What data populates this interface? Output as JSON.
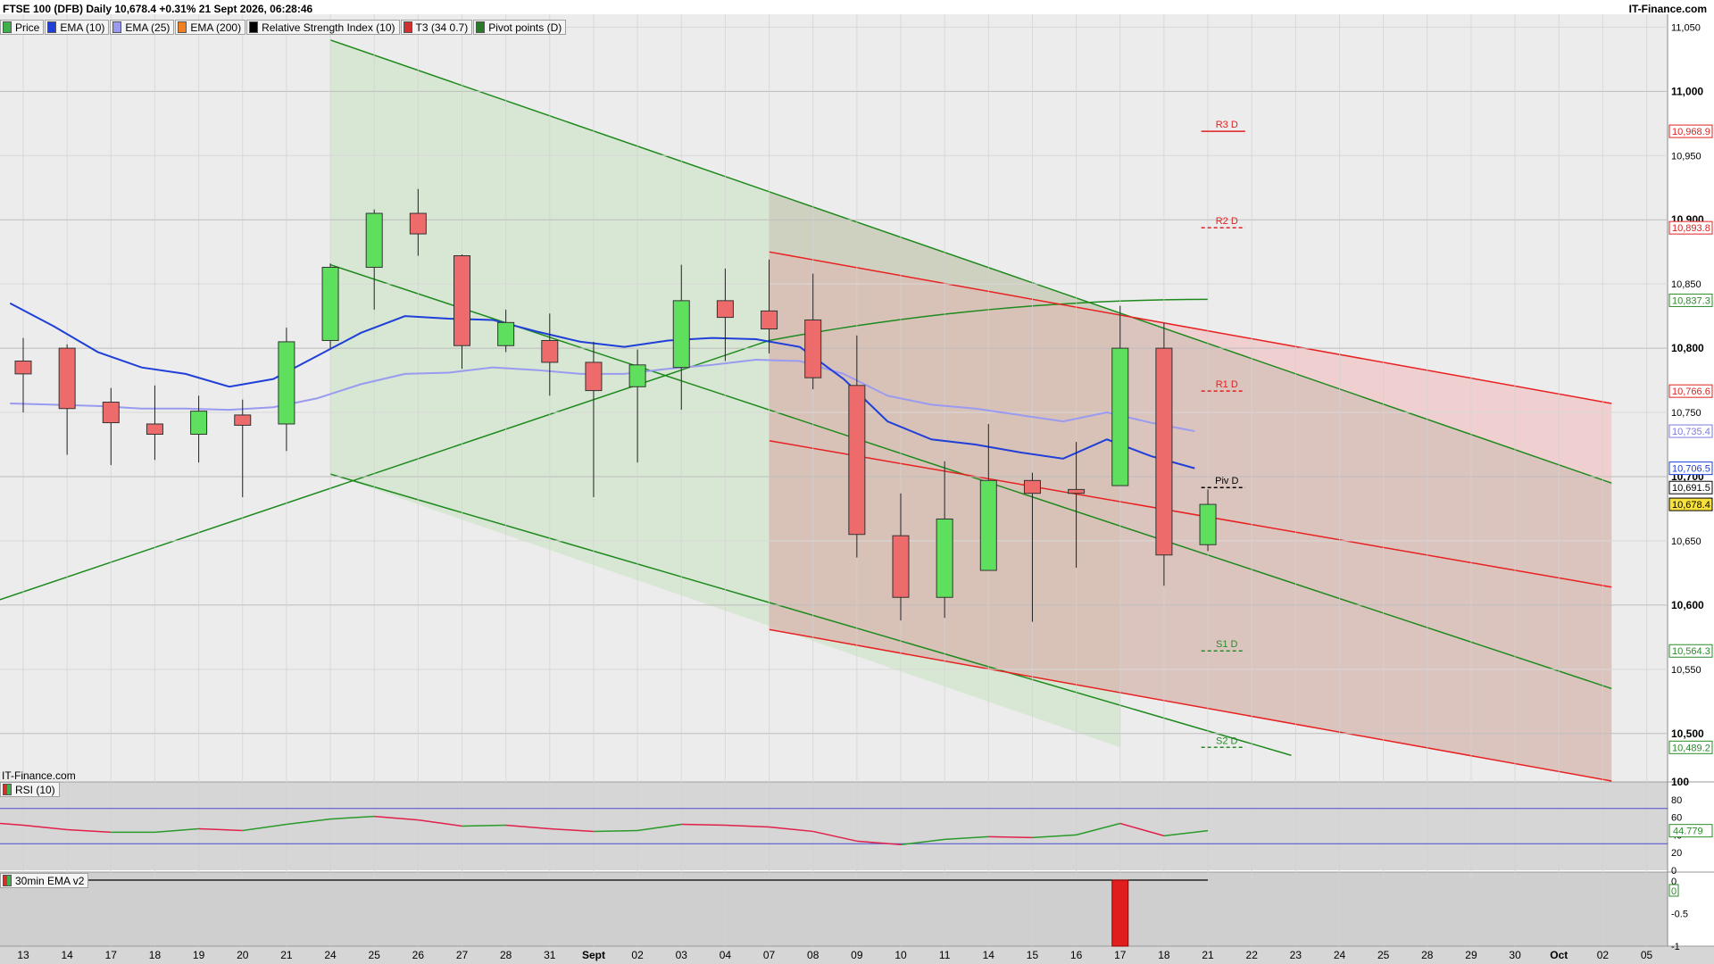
{
  "header": {
    "title": "FTSE 100 (DFB) Daily 10,678.4 +0.31% 21 Sept 2026, 06:28:46",
    "brand": "IT-Finance.com"
  },
  "legend": [
    {
      "label": "Price",
      "color": "#3db24a"
    },
    {
      "label": "EMA (10)",
      "color": "#1f3fd8"
    },
    {
      "label": "EMA (25)",
      "color": "#9a9af0"
    },
    {
      "label": "EMA (200)",
      "color": "#f08020"
    },
    {
      "label": "Relative Strength Index (10)",
      "color": "#000000"
    },
    {
      "label": "T3 (34 0.7)",
      "color": "#d03030"
    },
    {
      "label": "Pivot points (D)",
      "color": "#2a7a2a"
    }
  ],
  "watermark": "IT-Finance.com",
  "rsi_panel": {
    "label": "RSI (10)",
    "ticks": [
      "100",
      "80",
      "60",
      "40",
      "20",
      "0"
    ],
    "current": "44.779"
  },
  "ema30_panel": {
    "label": "30min EMA v2",
    "ticks": [
      "0",
      "-0.5",
      "-1"
    ],
    "current": "0"
  },
  "colors": {
    "up": "#5ee05e",
    "down": "#ee6b6b",
    "ema10": "#1f3fd8",
    "ema25": "#9a9af0",
    "channel_green": "#1e8a1e",
    "channel_red": "#e82020"
  },
  "price_axis": {
    "labels": [
      "11,050",
      "11,000",
      "10,950",
      "10,900",
      "10,850",
      "10,800",
      "10,750",
      "10,700",
      "10,650",
      "10,600",
      "10,550",
      "10,500"
    ]
  },
  "price_tags": [
    {
      "text": "10,968.9",
      "color": "#e02020",
      "bg": "#ffffff"
    },
    {
      "text": "10,893.8",
      "color": "#e02020",
      "bg": "#ffffff"
    },
    {
      "text": "10,837.3",
      "color": "#2a8a2a",
      "bg": "#ffffff"
    },
    {
      "text": "10,766.6",
      "color": "#e02020",
      "bg": "#ffffff"
    },
    {
      "text": "10,735.4",
      "color": "#7a7ae0",
      "bg": "#ffffff"
    },
    {
      "text": "10,706.5",
      "color": "#1f3fd8",
      "bg": "#ffffff"
    },
    {
      "text": "10,691.5",
      "color": "#000000",
      "bg": "#ffffff"
    },
    {
      "text": "10,678.4",
      "color": "#000000",
      "bg": "#f7e13a"
    },
    {
      "text": "10,564.3",
      "color": "#2a8a2a",
      "bg": "#ffffff"
    },
    {
      "text": "10,489.2",
      "color": "#2a8a2a",
      "bg": "#ffffff"
    }
  ],
  "pivots": [
    {
      "label": "R3 D",
      "value": 10968.9,
      "color": "#e02020",
      "dashed": false
    },
    {
      "label": "R2 D",
      "value": 10893.8,
      "color": "#e02020",
      "dashed": true
    },
    {
      "label": "R1 D",
      "value": 10766.6,
      "color": "#e02020",
      "dashed": true
    },
    {
      "label": "Piv D",
      "value": 10691.5,
      "color": "#000000",
      "dashed": true
    },
    {
      "label": "S1 D",
      "value": 10564.3,
      "color": "#2a8a2a",
      "dashed": true
    },
    {
      "label": "S2 D",
      "value": 10489.2,
      "color": "#2a8a2a",
      "dashed": true
    }
  ],
  "x_axis": {
    "labels": [
      "13",
      "14",
      "17",
      "18",
      "19",
      "20",
      "21",
      "24",
      "25",
      "26",
      "27",
      "28",
      "31",
      "Sept",
      "02",
      "03",
      "04",
      "07",
      "08",
      "09",
      "10",
      "11",
      "14",
      "15",
      "16",
      "17",
      "18",
      "21",
      "22",
      "23",
      "24",
      "25",
      "28",
      "29",
      "30",
      "Oct",
      "02",
      "05"
    ]
  },
  "chart_data": {
    "type": "candlestick",
    "title": "FTSE 100 (DFB) Daily",
    "categories": [
      "13",
      "14",
      "17",
      "18",
      "19",
      "20",
      "21",
      "24",
      "25",
      "26",
      "27",
      "28",
      "31",
      "Sept",
      "02",
      "03",
      "04",
      "07",
      "08",
      "09",
      "10",
      "11",
      "14",
      "15",
      "16",
      "17",
      "18",
      "21"
    ],
    "candles": [
      {
        "o": 10790,
        "h": 10808,
        "l": 10750,
        "c": 10780
      },
      {
        "o": 10800,
        "h": 10803,
        "l": 10717,
        "c": 10753
      },
      {
        "o": 10758,
        "h": 10769,
        "l": 10709,
        "c": 10742
      },
      {
        "o": 10741,
        "h": 10771,
        "l": 10713,
        "c": 10733
      },
      {
        "o": 10733,
        "h": 10763,
        "l": 10711,
        "c": 10751
      },
      {
        "o": 10748,
        "h": 10760,
        "l": 10684,
        "c": 10740
      },
      {
        "o": 10741,
        "h": 10816,
        "l": 10720,
        "c": 10805
      },
      {
        "o": 10806,
        "h": 10866,
        "l": 10800,
        "c": 10863
      },
      {
        "o": 10863,
        "h": 10908,
        "l": 10830,
        "c": 10905
      },
      {
        "o": 10905,
        "h": 10924,
        "l": 10872,
        "c": 10889
      },
      {
        "o": 10872,
        "h": 10873,
        "l": 10784,
        "c": 10802
      },
      {
        "o": 10802,
        "h": 10830,
        "l": 10797,
        "c": 10820
      },
      {
        "o": 10806,
        "h": 10827,
        "l": 10763,
        "c": 10789
      },
      {
        "o": 10789,
        "h": 10805,
        "l": 10684,
        "c": 10767
      },
      {
        "o": 10770,
        "h": 10799,
        "l": 10711,
        "c": 10787
      },
      {
        "o": 10785,
        "h": 10865,
        "l": 10752,
        "c": 10837
      },
      {
        "o": 10837,
        "h": 10862,
        "l": 10790,
        "c": 10824
      },
      {
        "o": 10829,
        "h": 10869,
        "l": 10796,
        "c": 10815
      },
      {
        "o": 10822,
        "h": 10858,
        "l": 10768,
        "c": 10777
      },
      {
        "o": 10771,
        "h": 10810,
        "l": 10637,
        "c": 10655
      },
      {
        "o": 10654,
        "h": 10687,
        "l": 10588,
        "c": 10606
      },
      {
        "o": 10606,
        "h": 10712,
        "l": 10590,
        "c": 10667
      },
      {
        "o": 10627,
        "h": 10741,
        "l": 10627,
        "c": 10697
      },
      {
        "o": 10697,
        "h": 10703,
        "l": 10587,
        "c": 10687
      },
      {
        "o": 10690,
        "h": 10727,
        "l": 10629,
        "c": 10687
      },
      {
        "o": 10693,
        "h": 10833,
        "l": 10693,
        "c": 10800
      },
      {
        "o": 10800,
        "h": 10820,
        "l": 10615,
        "c": 10639
      },
      {
        "o": 10647,
        "h": 10690,
        "l": 10642,
        "c": 10678.4
      }
    ],
    "ema10": [
      10835,
      10817,
      10797,
      10785,
      10780,
      10770,
      10776,
      10794,
      10812,
      10825,
      10823,
      10822,
      10813,
      10805,
      10801,
      10806,
      10808,
      10807,
      10801,
      10776,
      10743,
      10729,
      10725,
      10719,
      10714,
      10729,
      10716,
      10706.5
    ],
    "ema25": [
      10757,
      10756,
      10755,
      10753,
      10753,
      10752,
      10754,
      10761,
      10772,
      10780,
      10781,
      10785,
      10783,
      10780,
      10780,
      10784,
      10787,
      10791,
      10790,
      10780,
      10763,
      10756,
      10753,
      10748,
      10743,
      10750,
      10742,
      10735.4
    ],
    "rsi": [
      51,
      46,
      43,
      43,
      47,
      45,
      52,
      58,
      61,
      57,
      50,
      51,
      47,
      44,
      45,
      52,
      51,
      49,
      44,
      33,
      29,
      35,
      38,
      37,
      40,
      53,
      39,
      44.779
    ],
    "ema30_hist": [
      {
        "index": 25,
        "value": -1
      }
    ],
    "ylim": [
      10463,
      11060
    ],
    "rsi_levels": {
      "upper": 70,
      "lower": 30
    },
    "grid": true
  }
}
